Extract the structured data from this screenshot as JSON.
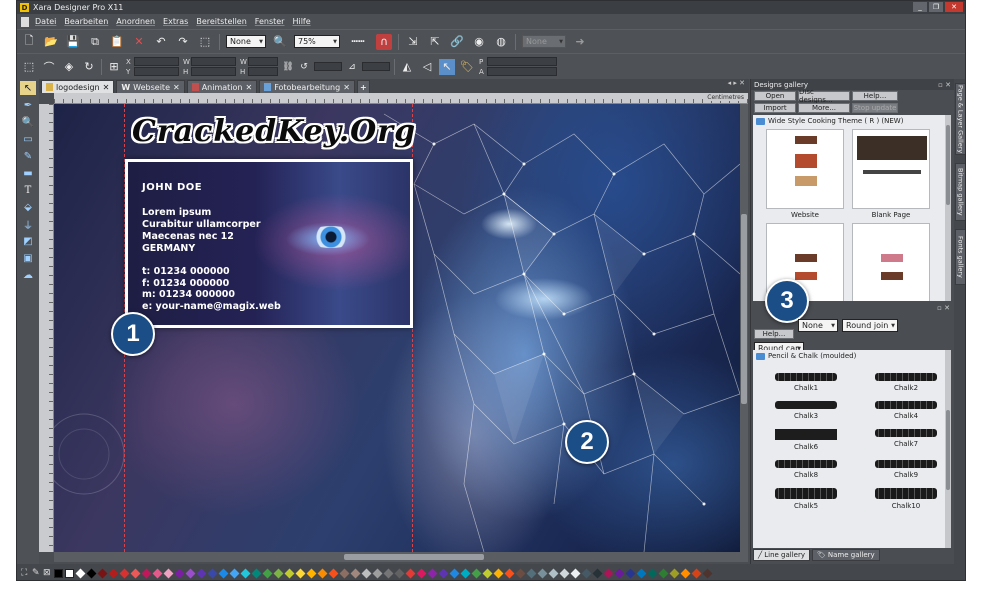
{
  "window": {
    "title": "Xara Designer Pro X11",
    "controls": [
      "_",
      "❐",
      "✕"
    ]
  },
  "menu": [
    "Datei",
    "Bearbeiten",
    "Anordnen",
    "Extras",
    "Bereitstellen",
    "Fenster",
    "Hilfe"
  ],
  "toolbar": {
    "blend_mode": "None",
    "zoom": "75%",
    "shadow_none": "None"
  },
  "infobar": {
    "x_label": "X",
    "y_label": "Y",
    "w_label": "W",
    "h_label": "H",
    "p_label": "P",
    "a_label": "A"
  },
  "tabs": [
    {
      "label": "logodesign",
      "active": true
    },
    {
      "label": "Webseite",
      "prefix": "W"
    },
    {
      "label": "Animation"
    },
    {
      "label": "Fotobearbeitung"
    }
  ],
  "tabs_controls": "◂ ▸ ✕",
  "ruler_unit": "Centimetres",
  "watermark": "CrackedKey.Org",
  "business_card": {
    "name": "JOHN DOE",
    "address": [
      "Lorem ipsum",
      "Curabitur ullamcorper",
      "Maecenas nec 12",
      "GERMANY"
    ],
    "contact": [
      "t: 01234 000000",
      "f: 01234 000000",
      "m: 01234 000000",
      "e: your-name@magix.web"
    ]
  },
  "badges": [
    "1",
    "2",
    "3"
  ],
  "designs_gallery": {
    "title": "Designs gallery",
    "buttons_row1": [
      "Open",
      "Disc designs...",
      "Help..."
    ],
    "buttons_row2": [
      "Import",
      "More...",
      "Stop update"
    ],
    "folder": "Wide Style Cooking Theme ( R ) (NEW)",
    "items": [
      "Website",
      "Blank Page",
      "",
      ""
    ]
  },
  "line_gallery": {
    "help": "Help...",
    "cap": "None",
    "join": "Round join",
    "round_cap": "Round cap",
    "folder": "Pencil & Chalk (moulded)",
    "strokes": [
      "Chalk1",
      "Chalk2",
      "Chalk3",
      "Chalk4",
      "Chalk6",
      "Chalk7",
      "Chalk8",
      "Chalk9",
      "Chalk5",
      "Chalk10"
    ]
  },
  "gallery_tabs": [
    "Line gallery",
    "Name gallery"
  ],
  "side_tabs": [
    "Page & Layer Gallery",
    "Bitmap gallery",
    "Fonts gallery"
  ],
  "palette_colors": [
    "#ffffff",
    "#000000",
    "#7a1414",
    "#b01e1e",
    "#d93030",
    "#e85a5a",
    "#c2185b",
    "#e05a8a",
    "#f0a0c0",
    "#7b1fa2",
    "#9c4dcc",
    "#5e35b1",
    "#3949ab",
    "#1e88e5",
    "#42a5f5",
    "#26c6da",
    "#00897b",
    "#43a047",
    "#7cb342",
    "#c0ca33",
    "#fdd835",
    "#ffb300",
    "#fb8c00",
    "#f4511e",
    "#8d6e63",
    "#a1887f",
    "#bdbdbd",
    "#9e9e9e",
    "#757575",
    "#616161",
    "#e53935",
    "#d81b60",
    "#8e24aa",
    "#5e35b1",
    "#1e88e5",
    "#00acc1",
    "#43a047",
    "#c0ca33",
    "#ffb300",
    "#f4511e",
    "#6d4c41",
    "#546e7a",
    "#78909c",
    "#b0bec5",
    "#cfd8dc",
    "#eceff1",
    "#455a64",
    "#263238",
    "#ad1457",
    "#6a1b9a",
    "#283593",
    "#0277bd",
    "#00695c",
    "#2e7d32",
    "#9e9d24",
    "#ff8f00",
    "#d84315",
    "#4e342e"
  ]
}
